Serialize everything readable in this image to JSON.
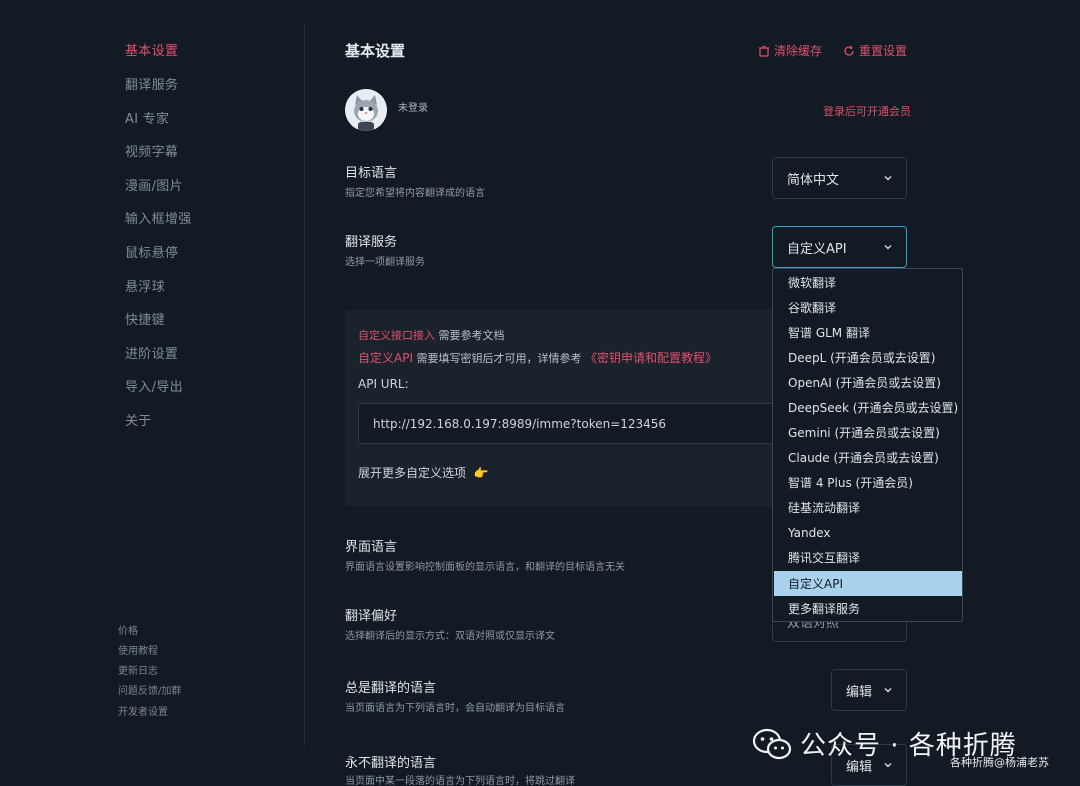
{
  "sidebar": {
    "items": [
      "基本设置",
      "翻译服务",
      "AI 专家",
      "视频字幕",
      "漫画/图片",
      "输入框增强",
      "鼠标悬停",
      "悬浮球",
      "快捷键",
      "进阶设置",
      "导入/导出",
      "关于"
    ],
    "footer": [
      "价格",
      "使用教程",
      "更新日志",
      "问题反馈/加群",
      "开发者设置"
    ]
  },
  "header": {
    "title": "基本设置",
    "clear_cache": "清除缓存",
    "reset": "重置设置"
  },
  "account": {
    "status": "未登录",
    "vip_link": "登录后可开通会员"
  },
  "settings": {
    "target_lang": {
      "title": "目标语言",
      "desc": "指定您希望将内容翻译成的语言",
      "value": "简体中文"
    },
    "service": {
      "title": "翻译服务",
      "desc": "选择一项翻译服务",
      "value": "自定义API"
    },
    "ui_lang": {
      "title": "界面语言",
      "desc": "界面语言设置影响控制面板的显示语言，和翻译的目标语言无关"
    },
    "pref": {
      "title": "翻译偏好",
      "desc": "选择翻译后的显示方式：双语对照或仅显示译文",
      "value": "双语对照"
    },
    "always": {
      "title": "总是翻译的语言",
      "desc": "当页面语言为下列语言时，会自动翻译为目标语言",
      "value": "编辑"
    },
    "never": {
      "title": "永不翻译的语言",
      "desc": "当页面中某一段落的语言为下列语言时，将跳过翻译",
      "value": "编辑"
    }
  },
  "custom_api": {
    "line1_link": "自定义接口接入",
    "line1_text": "需要参考文档",
    "line2_link": "自定义API",
    "line2_text": "需要填写密钥后才可用，详情参考",
    "line2_doc": "《密钥申请和配置教程》",
    "url_label": "API URL:",
    "url_value": "http://192.168.0.197:8989/imme?token=123456",
    "expand": "展开更多自定义选项",
    "expand_emoji": "👉"
  },
  "dropdown": {
    "options": [
      "微软翻译",
      "谷歌翻译",
      "智谱 GLM 翻译",
      "DeepL (开通会员或去设置)",
      "OpenAI (开通会员或去设置)",
      "DeepSeek (开通会员或去设置)",
      "Gemini (开通会员或去设置)",
      "Claude (开通会员或去设置)",
      "智谱 4 Plus (开通会员)",
      "硅基流动翻译",
      "Yandex",
      "腾讯交互翻译",
      "自定义API",
      "更多翻译服务"
    ],
    "selected": "自定义API"
  },
  "watermark": {
    "main": "公众号 · 各种折腾",
    "sub": "各种折腾@杨浦老苏"
  },
  "colors": {
    "accent": "#e0506c",
    "bg": "#121a23",
    "selected": "#a9d3ec",
    "focus": "#3aa0c8"
  }
}
